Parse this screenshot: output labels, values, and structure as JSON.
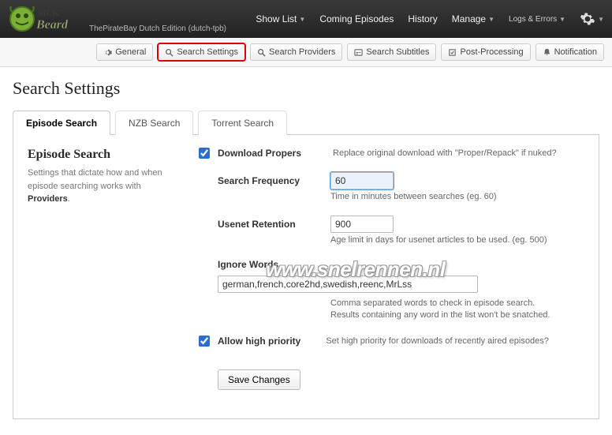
{
  "header": {
    "tagline": "ThePirateBay Dutch Edition (dutch-tpb)",
    "nav": {
      "show_list": "Show List",
      "coming_episodes": "Coming Episodes",
      "history": "History",
      "manage": "Manage",
      "logs_errors": "Logs & Errors"
    }
  },
  "subnav": {
    "general": "General",
    "search_settings": "Search Settings",
    "search_providers": "Search Providers",
    "search_subtitles": "Search Subtitles",
    "post_processing": "Post-Processing",
    "notification": "Notification"
  },
  "page_title": "Search Settings",
  "tabs": {
    "episode_search": "Episode Search",
    "nzb_search": "NZB Search",
    "torrent_search": "Torrent Search"
  },
  "section": {
    "title": "Episode Search",
    "desc_line1": "Settings that dictate how and when episode searching works with ",
    "desc_providers": "Providers",
    "desc_dot": "."
  },
  "form": {
    "download_propers": {
      "label": "Download Propers",
      "checked": true,
      "desc": "Replace original download with \"Proper/Repack\" if nuked?"
    },
    "search_frequency": {
      "label": "Search Frequency",
      "value": "60",
      "hint": "Time in minutes between searches (eg. 60)"
    },
    "usenet_retention": {
      "label": "Usenet Retention",
      "value": "900",
      "hint": "Age limit in days for usenet articles to be used. (eg. 500)"
    },
    "ignore_words": {
      "label": "Ignore Words",
      "value": "german,french,core2hd,swedish,reenc,MrLss",
      "hint1": "Comma separated words to check in episode search.",
      "hint2": "Results containing any word in the list won't be snatched."
    },
    "allow_high_priority": {
      "label": "Allow high priority",
      "checked": true,
      "desc": "Set high priority for downloads of recently aired episodes?"
    },
    "save_button": "Save Changes"
  },
  "watermark": "www.snelrennen.nl"
}
